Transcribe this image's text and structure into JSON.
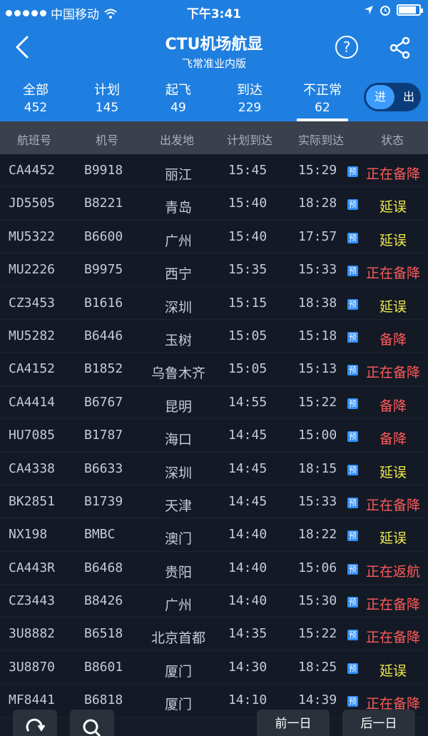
{
  "status_bar": {
    "carrier": "中国移动",
    "time": "下午3:41"
  },
  "nav": {
    "title": "CTU机场航显",
    "subtitle": "飞常准业内版"
  },
  "tabs": [
    {
      "label": "全部",
      "count": "452"
    },
    {
      "label": "计划",
      "count": "145"
    },
    {
      "label": "起飞",
      "count": "49"
    },
    {
      "label": "到达",
      "count": "229"
    },
    {
      "label": "不正常",
      "count": "62"
    }
  ],
  "toggle": {
    "in": "进",
    "out": "出"
  },
  "table": {
    "headers": [
      "航班号",
      "机号",
      "出发地",
      "计划到达",
      "实际到达",
      "状态"
    ],
    "pre_icon": "预",
    "rows": [
      {
        "flight": "CA4452",
        "reg": "B9918",
        "origin": "丽江",
        "planned": "15:45",
        "actual": "15:29",
        "status": "正在备降",
        "tone": "red"
      },
      {
        "flight": "JD5505",
        "reg": "B8221",
        "origin": "青岛",
        "planned": "15:40",
        "actual": "18:28",
        "status": "延误",
        "tone": "yellow"
      },
      {
        "flight": "MU5322",
        "reg": "B6600",
        "origin": "广州",
        "planned": "15:40",
        "actual": "17:57",
        "status": "延误",
        "tone": "yellow"
      },
      {
        "flight": "MU2226",
        "reg": "B9975",
        "origin": "西宁",
        "planned": "15:35",
        "actual": "15:33",
        "status": "正在备降",
        "tone": "red"
      },
      {
        "flight": "CZ3453",
        "reg": "B1616",
        "origin": "深圳",
        "planned": "15:15",
        "actual": "18:38",
        "status": "延误",
        "tone": "yellow"
      },
      {
        "flight": "MU5282",
        "reg": "B6446",
        "origin": "玉树",
        "planned": "15:05",
        "actual": "15:18",
        "status": "备降",
        "tone": "red"
      },
      {
        "flight": "CA4152",
        "reg": "B1852",
        "origin": "乌鲁木齐",
        "planned": "15:05",
        "actual": "15:13",
        "status": "正在备降",
        "tone": "red"
      },
      {
        "flight": "CA4414",
        "reg": "B6767",
        "origin": "昆明",
        "planned": "14:55",
        "actual": "15:22",
        "status": "备降",
        "tone": "red"
      },
      {
        "flight": "HU7085",
        "reg": "B1787",
        "origin": "海口",
        "planned": "14:45",
        "actual": "15:00",
        "status": "备降",
        "tone": "red"
      },
      {
        "flight": "CA4338",
        "reg": "B6633",
        "origin": "深圳",
        "planned": "14:45",
        "actual": "18:15",
        "status": "延误",
        "tone": "yellow"
      },
      {
        "flight": "BK2851",
        "reg": "B1739",
        "origin": "天津",
        "planned": "14:45",
        "actual": "15:33",
        "status": "正在备降",
        "tone": "red"
      },
      {
        "flight": "NX198",
        "reg": "BMBC",
        "origin": "澳门",
        "planned": "14:40",
        "actual": "18:22",
        "status": "延误",
        "tone": "yellow"
      },
      {
        "flight": "CA443R",
        "reg": "B6468",
        "origin": "贵阳",
        "planned": "14:40",
        "actual": "15:06",
        "status": "正在返航",
        "tone": "red"
      },
      {
        "flight": "CZ3443",
        "reg": "B8426",
        "origin": "广州",
        "planned": "14:40",
        "actual": "15:30",
        "status": "正在备降",
        "tone": "red"
      },
      {
        "flight": "3U8882",
        "reg": "B6518",
        "origin": "北京首都",
        "planned": "14:35",
        "actual": "15:22",
        "status": "正在备降",
        "tone": "red"
      },
      {
        "flight": "3U8870",
        "reg": "B8601",
        "origin": "厦门",
        "planned": "14:30",
        "actual": "18:25",
        "status": "延误",
        "tone": "yellow"
      },
      {
        "flight": "MF8441",
        "reg": "B6818",
        "origin": "厦门",
        "planned": "14:10",
        "actual": "14:39",
        "status": "正在备降",
        "tone": "red"
      }
    ]
  },
  "bottom": {
    "prev_day": "前一日",
    "next_day": "后一日"
  },
  "colors": {
    "brand_blue": "#1f7fe0",
    "status_red": "#ff5a5a",
    "status_yellow": "#f2ea4a"
  }
}
